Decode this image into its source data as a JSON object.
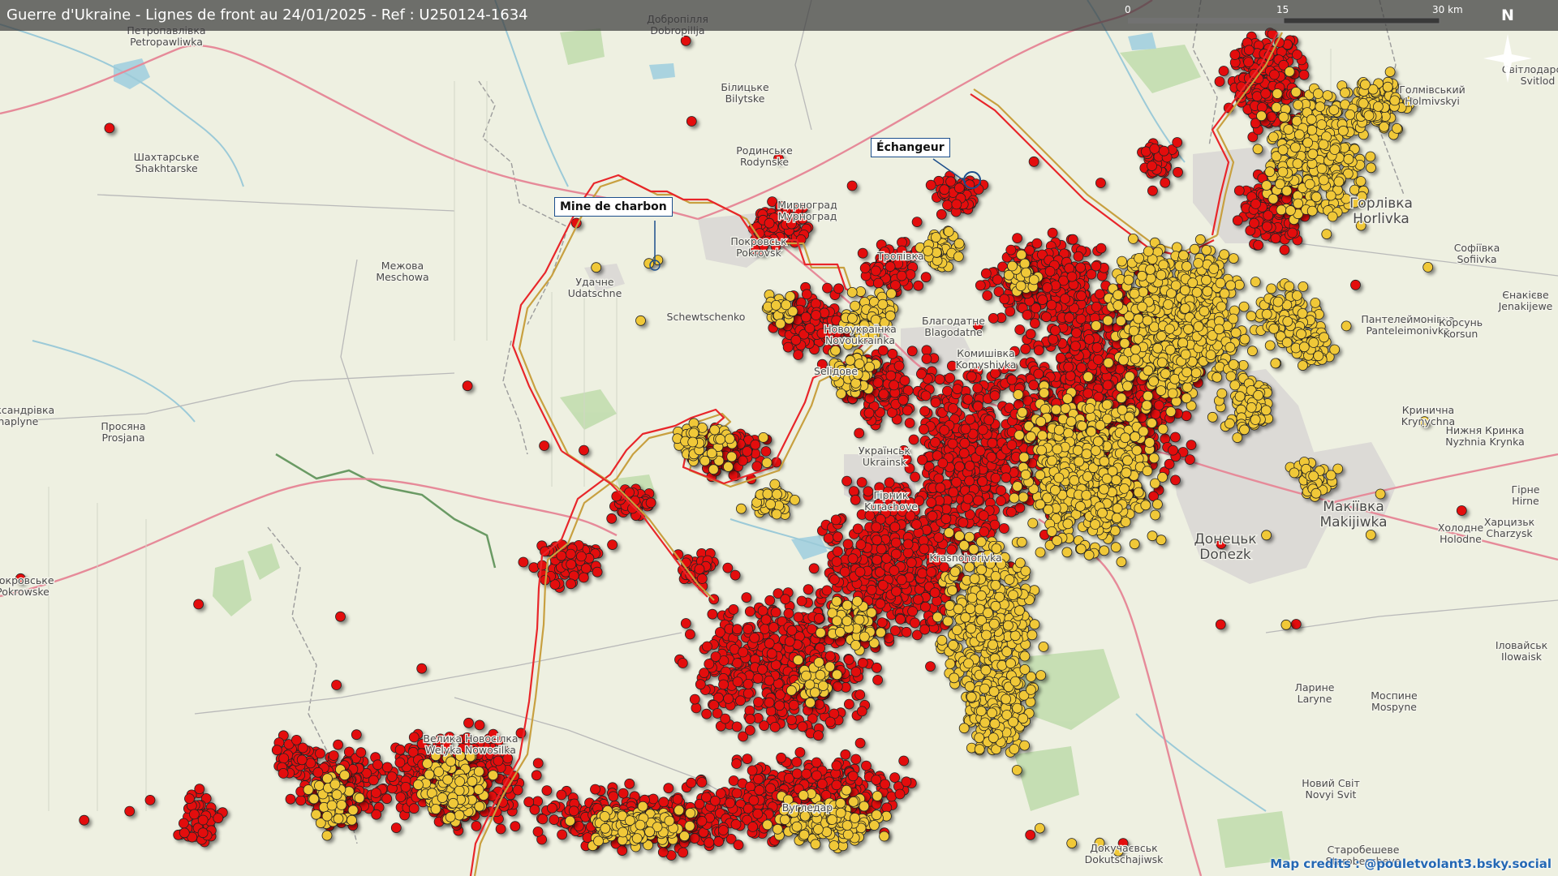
{
  "title": "Guerre d'Ukraine - Lignes de front au 24/01/2025 - Ref : U250124-1634",
  "scale": {
    "ticks": [
      "0",
      "15",
      "30 km"
    ]
  },
  "north": "N",
  "credits": "Map credits : @pouletvolant3.bsky.social",
  "callouts": [
    {
      "text": "Mine de charbon"
    },
    {
      "text": "Échangeur"
    }
  ],
  "colors": {
    "russian_strike": "#e31010",
    "ukrainian_strike": "#f0c838",
    "front_line_russian": "#e8262a",
    "front_line_ukrainian": "#c8a040",
    "callout_border": "#1c4e8c",
    "credits": "#2468b4"
  },
  "place_labels": [
    {
      "lines": [
        "Петропавлівка",
        "Petropawliwka"
      ]
    },
    {
      "lines": [
        "Добропілля",
        "Dobropillja"
      ]
    },
    {
      "lines": [
        "Білицьке",
        "Bilytske"
      ]
    },
    {
      "lines": [
        "Родинське",
        "Rodynske"
      ]
    },
    {
      "lines": [
        "Шахтарське",
        "Shakhtarske"
      ]
    },
    {
      "lines": [
        "Мирноград",
        "Mурноград"
      ]
    },
    {
      "lines": [
        "Покровськ",
        "Pokrovsk"
      ]
    },
    {
      "lines": [
        "Межова",
        "Meschowa"
      ]
    },
    {
      "lines": [
        "Удачне",
        "Udatschne"
      ]
    },
    {
      "lines": [
        "Schewtschenko"
      ]
    },
    {
      "lines": [
        "Новоукраїнка",
        "Novoukrainka"
      ]
    },
    {
      "lines": [
        "Благодатне",
        "Blagodatne"
      ]
    },
    {
      "lines": [
        "Комишівка",
        "Komyshivka"
      ]
    },
    {
      "lines": [
        "Тропівка"
      ]
    },
    {
      "lines": [
        "Seliдове"
      ]
    },
    {
      "lines": [
        "Українськ",
        "Ukrainsk"
      ]
    },
    {
      "lines": [
        "Гірник",
        "Kurachove"
      ]
    },
    {
      "lines": [
        "Krasnohorivka"
      ]
    },
    {
      "lines": [
        "Просяна",
        "Prosjana"
      ]
    },
    {
      "lines": [
        "Олександрівка",
        "Chaplyne"
      ]
    },
    {
      "lines": [
        "Покровське",
        "Pokrowske"
      ]
    },
    {
      "lines": [
        "Велика Новосілка",
        "Welyka Nowosilka"
      ]
    },
    {
      "lines": [
        "Вугледар"
      ]
    },
    {
      "lines": [
        "Докучаєвськ",
        "Dokutschajiwsk"
      ]
    },
    {
      "lines": [
        "Світлодарськ",
        "Svitlod"
      ]
    },
    {
      "lines": [
        "Голмівський",
        "Holmivskyi"
      ]
    },
    {
      "lines": [
        "Горлівка",
        "Horlivka"
      ]
    },
    {
      "lines": [
        "Софіївка",
        "Sofiivka"
      ]
    },
    {
      "lines": [
        "Єнакієве",
        "Jenakijewe"
      ]
    },
    {
      "lines": [
        "Пантелеймонівка",
        "Panteleimonivka"
      ]
    },
    {
      "lines": [
        "Корсунь",
        "Korsun"
      ]
    },
    {
      "lines": [
        "Кринична",
        "Krynychna"
      ]
    },
    {
      "lines": [
        "Нижня Кринка",
        "Nyzhnia Krynka"
      ]
    },
    {
      "lines": [
        "Гірне",
        "Hirne"
      ]
    },
    {
      "lines": [
        "Макіївка",
        "Makijiwka"
      ]
    },
    {
      "lines": [
        "Холодне",
        "Holodne"
      ]
    },
    {
      "lines": [
        "Донецьк",
        "Donezk"
      ]
    },
    {
      "lines": [
        "Харцизьк",
        "Charzysk"
      ]
    },
    {
      "lines": [
        "Іловайськ",
        "Ilowaisk"
      ]
    },
    {
      "lines": [
        "Ларине",
        "Laryne"
      ]
    },
    {
      "lines": [
        "Моспине",
        "Mospyne"
      ]
    },
    {
      "lines": [
        "Новий Світ",
        "Novyi Svit"
      ]
    },
    {
      "lines": [
        "Старобешеве",
        "Starobescheve"
      ]
    }
  ]
}
